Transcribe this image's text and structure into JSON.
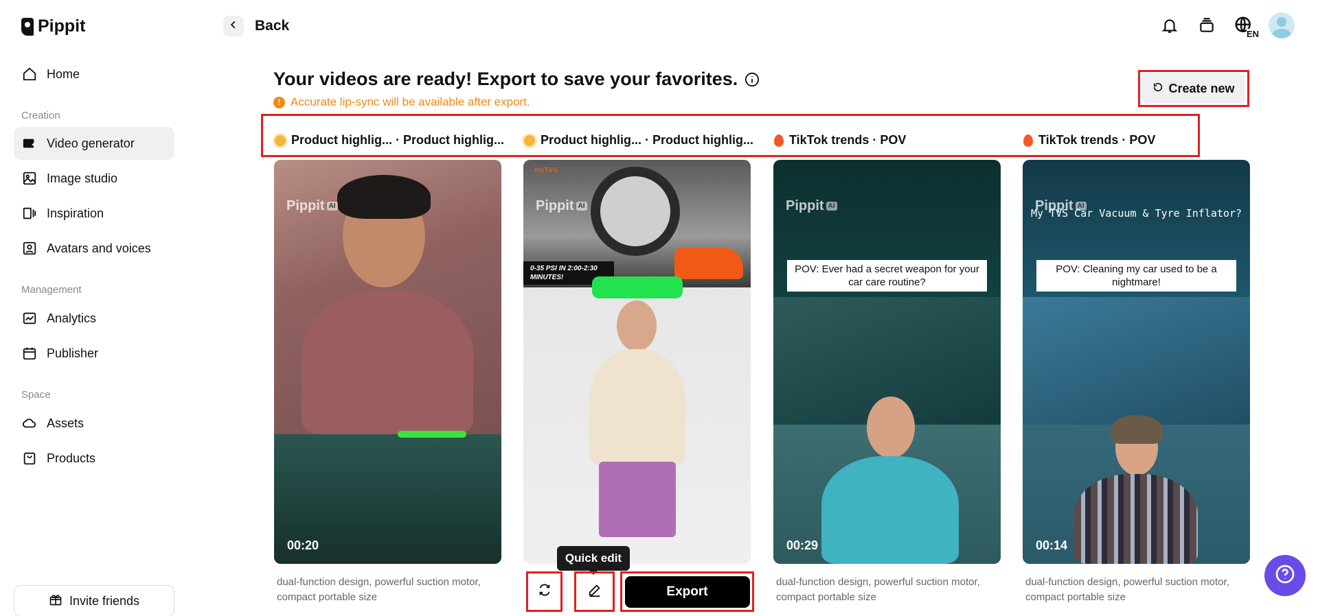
{
  "brand": {
    "name": "Pippit"
  },
  "sidebar": {
    "home": "Home",
    "sections": {
      "creation": "Creation",
      "management": "Management",
      "space": "Space"
    },
    "items": [
      {
        "label": "Home"
      },
      {
        "label": "Video generator"
      },
      {
        "label": "Image studio"
      },
      {
        "label": "Inspiration"
      },
      {
        "label": "Avatars and voices"
      },
      {
        "label": "Analytics"
      },
      {
        "label": "Publisher"
      },
      {
        "label": "Assets"
      },
      {
        "label": "Products"
      }
    ],
    "invite": "Invite friends"
  },
  "header": {
    "back": "Back",
    "language_badge": "EN"
  },
  "main": {
    "title": "Your videos are ready! Export to save your favorites.",
    "warning": "Accurate lip-sync will be available after export.",
    "create_new": "Create new",
    "tags": [
      {
        "text": "Product highlig...  · Product highlig..."
      },
      {
        "text": "Product highlig...  · Product highlig..."
      },
      {
        "text": "TikTok trends · POV"
      },
      {
        "text": "TikTok trends · POV"
      }
    ],
    "cards": [
      {
        "duration": "00:20",
        "description": "dual-function design, powerful suction motor, compact portable size",
        "watermark": "Pippit",
        "watermark_badge": "AI"
      },
      {
        "duration": "",
        "watermark": "Pippit",
        "watermark_badge": "AI",
        "overlay_brand": "myTVS",
        "overlay_text": "0-35 PSI IN 2:00-2:30 MINUTES!"
      },
      {
        "duration": "00:29",
        "description": "dual-function design, powerful suction motor, compact portable size",
        "caption": "POV: Ever had a secret weapon for your car care routine?",
        "watermark": "Pippit",
        "watermark_badge": "AI"
      },
      {
        "duration": "00:14",
        "description": "dual-function design, powerful suction motor, compact portable size",
        "caption": "POV: Cleaning my car used to be a nightmare!",
        "title_overlay": "My TVS Car Vacuum & Tyre Inflator?",
        "watermark": "Pippit",
        "watermark_badge": "AI"
      }
    ],
    "actions": {
      "quick_edit_tooltip": "Quick edit",
      "export": "Export"
    }
  },
  "colors": {
    "highlight": "#e02020",
    "warning": "#f08a10",
    "help": "#6b4be8"
  }
}
